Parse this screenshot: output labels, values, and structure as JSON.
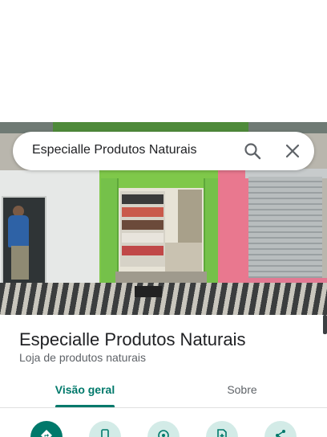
{
  "search": {
    "query": "Especialle Produtos Naturais"
  },
  "place": {
    "name": "Especialle Produtos Naturais",
    "category": "Loja de produtos naturais"
  },
  "tabs": [
    {
      "label": "Visão geral",
      "active": true
    },
    {
      "label": "Sobre",
      "active": false
    }
  ],
  "actions": [
    {
      "icon": "directions-icon",
      "primary": true
    },
    {
      "icon": "phone-icon",
      "primary": false
    },
    {
      "icon": "location-pin-icon",
      "primary": false
    },
    {
      "icon": "save-icon",
      "primary": false
    },
    {
      "icon": "share-icon",
      "primary": false
    }
  ],
  "colors": {
    "accent": "#00796b",
    "action_bg": "#d3ebe7",
    "text_primary": "#202124",
    "text_secondary": "#5f6368"
  }
}
